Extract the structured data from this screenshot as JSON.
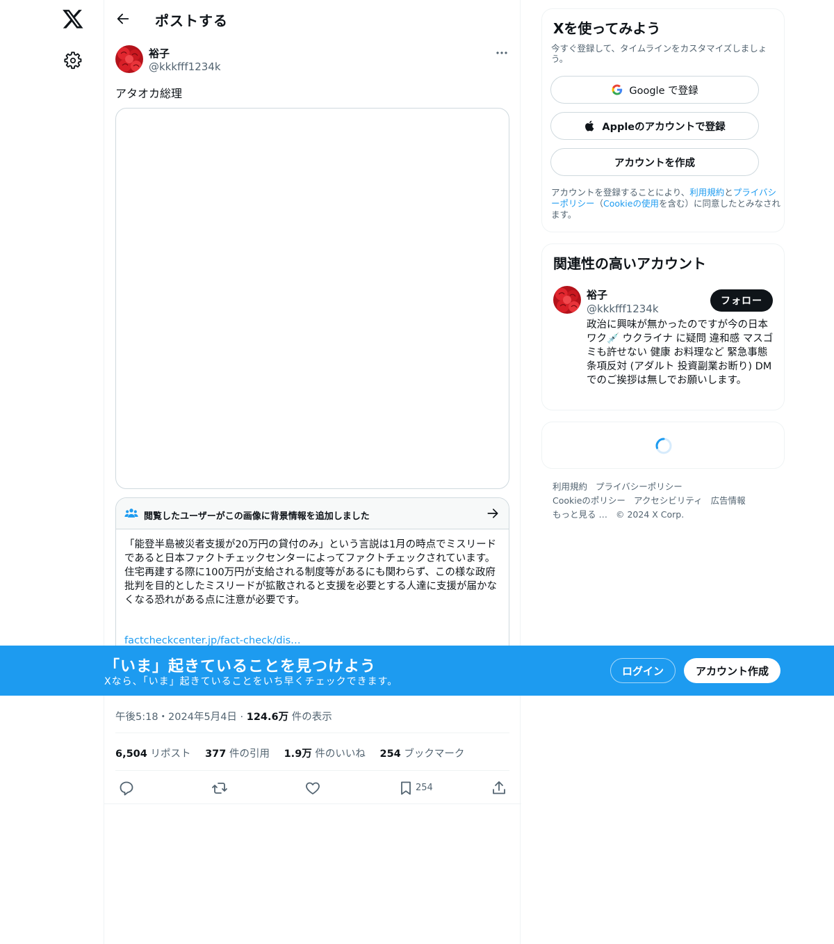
{
  "nav": {
    "logo_icon": "x-logo-icon",
    "settings_icon": "gear-icon"
  },
  "header": {
    "title": "ポストする",
    "back_icon": "arrow-left-icon"
  },
  "post": {
    "author_name": "裕子",
    "author_handle": "@kkkfff1234k",
    "text": "アタオカ総理",
    "timestamp": "午後5:18・2024年5月4日",
    "views_value": "124.6万",
    "views_label": "件の表示",
    "meta_separator": "·"
  },
  "community_note": {
    "title": "閲覧したユーザーがこの画像に背景情報を追加しました",
    "body": "「能登半島被災者支援が20万円の貸付のみ」という言説は1月の時点でミスリードであると日本ファクトチェックセンターによってファクトチェックされています。\n住宅再建する際に100万円が支給される制度等があるにも関わらず、この様な政府批判を目的としたミスリードが拡散されると支援を必要とする人達に支援が届かなくなる恐れがある点に注意が必要です。",
    "link": "factcheckcenter.jp/fact-check/dis…"
  },
  "stats": [
    {
      "value": "6,504",
      "label": "リポスト"
    },
    {
      "value": "377",
      "label": "件の引用"
    },
    {
      "value": "1.9万",
      "label": "件のいいね"
    },
    {
      "value": "254",
      "label": "ブックマーク"
    }
  ],
  "actions": {
    "reply_icon": "reply-icon",
    "repost_icon": "repost-icon",
    "like_icon": "heart-icon",
    "bookmark_icon": "bookmark-icon",
    "bookmark_count": "254",
    "share_icon": "share-icon"
  },
  "signup": {
    "title": "Xを使ってみよう",
    "desc": "今すぐ登録して、タイムラインをカスタマイズしましょう。",
    "google_label": "Google で登録",
    "apple_label": "Appleのアカウントで登録",
    "create_label": "アカウントを作成",
    "terms_1": "アカウントを登録することにより、",
    "terms_link_tos": "利用規約",
    "terms_2": "と",
    "terms_link_privacy": "プライバシーポリシー",
    "terms_3": "（",
    "terms_link_cookie": "Cookieの使用",
    "terms_4": "を含む）に同意したとみなされます。"
  },
  "related": {
    "title": "関連性の高いアカウント",
    "name": "裕子",
    "handle": "@kkkfff1234k",
    "follow_label": "フォロー",
    "bio": "政治に興味が無かったのですが今の日本 ワク💉 ウクライナ に疑問 違和感 マスゴミも許せない 健康 お料理など 緊急事態条項反対 (アダルト 投資副業お断り) DMでのご挨拶は無しでお願いします。"
  },
  "footer": {
    "links": [
      "利用規約",
      "プライバシーポリシー",
      "Cookieのポリシー",
      "アクセシビリティ",
      "広告情報",
      "もっと見る …",
      "© 2024 X Corp."
    ]
  },
  "banner": {
    "title": "「いま」起きていることを見つけよう",
    "subtitle": "Xなら、「いま」起きていることをいち早くチェックできます。",
    "login_label": "ログイン",
    "signup_label": "アカウント作成"
  },
  "colors": {
    "accent": "#1d9bf0",
    "text": "#0f1419",
    "secondary": "#536471",
    "border": "#cfd9de"
  }
}
